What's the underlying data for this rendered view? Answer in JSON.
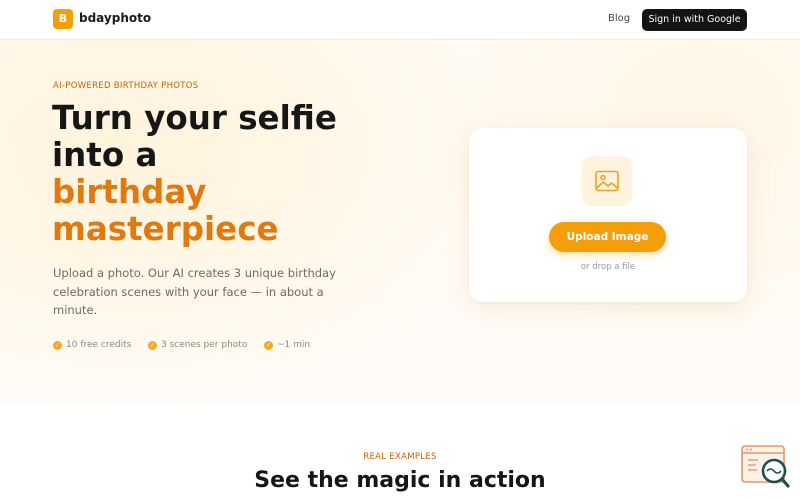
{
  "header": {
    "logo_letter": "B",
    "brand": "bdayphoto",
    "nav_blog": "Blog",
    "signin_label": "Sign in with Google"
  },
  "hero": {
    "eyebrow": "AI-POWERED BIRTHDAY PHOTOS",
    "headline_line1": "Turn your selfie",
    "headline_line2": "into a",
    "headline_accent1": "birthday",
    "headline_accent2": "masterpiece",
    "subtext": "Upload a photo. Our AI creates 3 unique birthday celebration scenes with your face — in about a minute.",
    "features": [
      "10 free credits",
      "3 scenes per photo",
      "~1 min"
    ],
    "check_glyph": "✓"
  },
  "upload": {
    "icon": "image-icon",
    "button_label": "Upload Image",
    "drop_text": "or drop a file"
  },
  "examples": {
    "eyebrow": "REAL EXAMPLES",
    "title": "See the magic in action"
  },
  "colors": {
    "accent": "#f59e0b",
    "accent_text": "#e07a10",
    "dark_button": "#141414"
  },
  "widget": {
    "icon": "search-inspect-icon"
  }
}
